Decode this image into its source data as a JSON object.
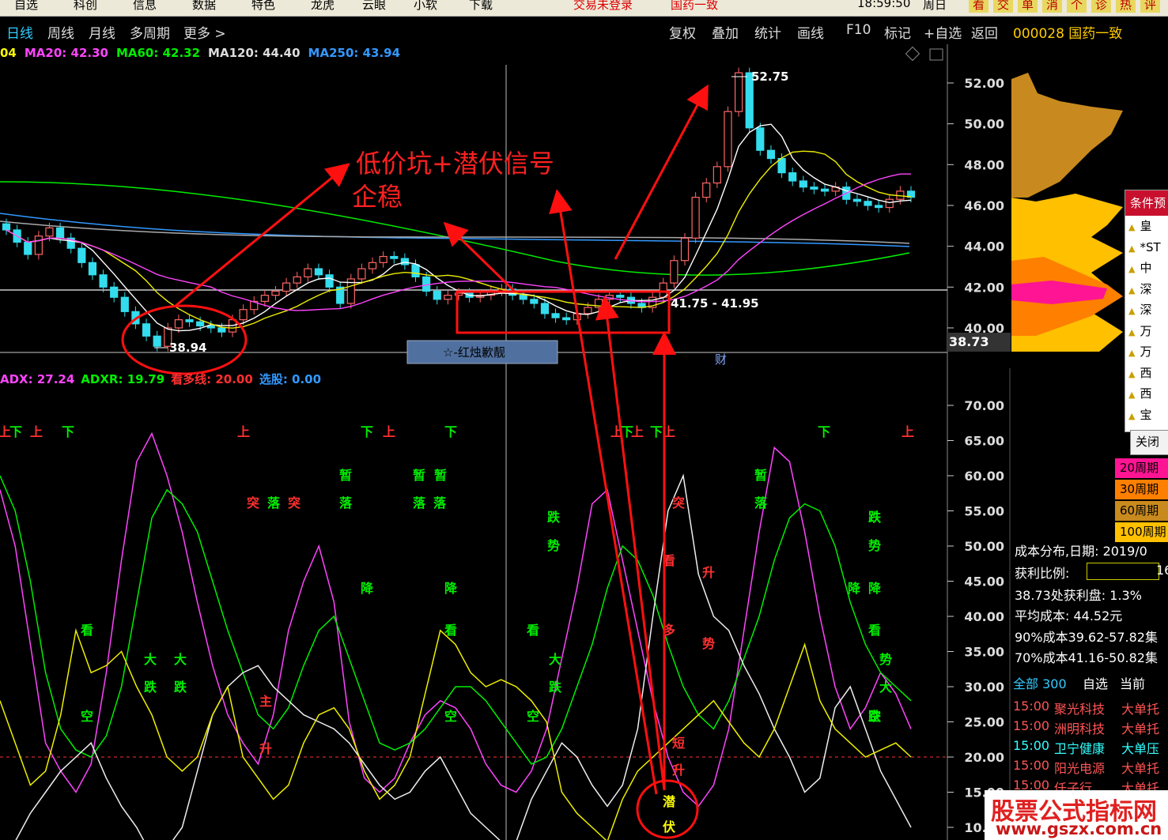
{
  "menu": {
    "items": [
      "自选",
      "科创",
      "信息",
      "数据",
      "特色",
      "龙虎",
      "云眼",
      "小软",
      "下载"
    ],
    "login": "交易未登录",
    "stock_name": "国药一致",
    "time": "18:59:50",
    "weekday": "周日",
    "right_buttons": [
      "看",
      "交",
      "单",
      "消",
      "个",
      "诊",
      "热",
      "评"
    ]
  },
  "toolbar": {
    "periods": [
      "日线",
      "周线",
      "月线",
      "多周期",
      "更多 >"
    ],
    "actions": [
      "复权",
      "叠加",
      "统计",
      "画线",
      "F10",
      "标记",
      "+自选",
      "返回"
    ],
    "stock_code": "000028 国药一致"
  },
  "ma_legend": [
    {
      "label": "04",
      "color": "#ffff00"
    },
    {
      "label": "MA20: 42.30",
      "color": "#ff44ff"
    },
    {
      "label": "MA60: 42.32",
      "color": "#00ee00"
    },
    {
      "label": "MA120: 44.40",
      "color": "#dddddd"
    },
    {
      "label": "MA250: 43.94",
      "color": "#3399ff"
    }
  ],
  "adx_legend": [
    {
      "label": "ADX: 27.24",
      "color": "#ff44ff"
    },
    {
      "label": "ADXR: 19.79",
      "color": "#00ee00"
    },
    {
      "label": "看多线: 20.00",
      "color": "#ff3030"
    },
    {
      "label": "选股: 0.00",
      "color": "#3399ff"
    }
  ],
  "annotations": {
    "main_text_line1": "低价坑+潜伏信号",
    "main_text_line2": "企稳",
    "peak_label": "52.75",
    "low_label": "38.94",
    "range_label": "41.75 - 41.95",
    "price_marker": "38.73",
    "event_box": "☆-红烛歉靓",
    "cai_mark": "财"
  },
  "price_axis": {
    "ticks": [
      "52.00",
      "50.00",
      "48.00",
      "46.00",
      "44.00",
      "42.00",
      "40.00"
    ]
  },
  "indicator_axis": {
    "ticks": [
      "70.00",
      "65.00",
      "60.00",
      "55.00",
      "50.00",
      "45.00",
      "40.00",
      "35.00",
      "30.00",
      "25.00",
      "20.00",
      "15.00",
      "10.00"
    ]
  },
  "cost_info": {
    "lines": [
      "成本分布,日期: 2019/0",
      "获利比例:",
      "38.73处获利盘: 1.3%",
      "平均成本: 44.52元",
      "90%成本39.62-57.82集",
      "70%成本41.16-50.82集"
    ],
    "profit_value": "16"
  },
  "condition_panel": {
    "title": "条件预",
    "items": [
      "皇",
      "*ST",
      "中",
      "深",
      "深",
      "万",
      "万",
      "西",
      "西",
      "宝"
    ],
    "close": "关闭"
  },
  "periods_legend": [
    {
      "label": "20周期",
      "color": "#ff1493"
    },
    {
      "label": "30周期",
      "color": "#ff7f00"
    },
    {
      "label": "60周期",
      "color": "#c88a1e"
    },
    {
      "label": "100周期",
      "color": "#ffc000"
    }
  ],
  "list_tabs": [
    "全部 300",
    "自选",
    "当前"
  ],
  "news": [
    {
      "time": "15:00",
      "name": "聚光科技",
      "event": "大单托",
      "color": "#ff5555"
    },
    {
      "time": "15:00",
      "name": "洲明科技",
      "event": "大单托",
      "color": "#ff5555"
    },
    {
      "time": "15:00",
      "name": "卫宁健康",
      "event": "大单压",
      "color": "#33ffff"
    },
    {
      "time": "15:00",
      "name": "阳光电源",
      "event": "大单托",
      "color": "#ff5555"
    },
    {
      "time": "15:00",
      "name": "仟子行",
      "event": "大单托",
      "color": "#ff5555"
    }
  ],
  "signal_words": [
    "上",
    "下",
    "上",
    "下",
    "上",
    "下",
    "上",
    "下",
    "上",
    "下",
    "上",
    "下",
    "上",
    "下",
    "上",
    "暂",
    "暂",
    "暂",
    "暂",
    "突",
    "落",
    "突",
    "落",
    "落",
    "落",
    "落",
    "跌",
    "势",
    "降",
    "降",
    "降",
    "降",
    "看",
    "看",
    "看",
    "看",
    "大",
    "大",
    "大",
    "跌",
    "跌",
    "跌",
    "空",
    "空",
    "空",
    "空",
    "跌",
    "势",
    "主",
    "升",
    "看",
    "多",
    "升",
    "势",
    "突",
    "短",
    "升",
    "潜",
    "伏",
    "跌",
    "势",
    "大",
    "跌",
    "空"
  ],
  "watermark": {
    "line1": "股票公式指标网",
    "line2": "www.gszx.com.cn"
  },
  "chart_data": [
    {
      "type": "candlestick",
      "title": "",
      "ylim": [
        38.73,
        53.2
      ],
      "peak": 52.75,
      "trough": 38.94,
      "moving_averages": {
        "MA20": 42.3,
        "MA60": 42.32,
        "MA120": 44.4,
        "MA250": 43.94
      },
      "closes": [
        44.8,
        44.2,
        43.6,
        44.5,
        44.9,
        44.4,
        43.9,
        43.2,
        42.6,
        42.0,
        41.5,
        40.8,
        40.2,
        39.6,
        39.1,
        40.0,
        40.4,
        40.3,
        40.1,
        40.0,
        39.8,
        40.4,
        40.9,
        41.3,
        41.6,
        41.8,
        42.2,
        42.5,
        42.9,
        42.6,
        42.0,
        41.2,
        42.4,
        42.9,
        43.2,
        43.5,
        43.4,
        43.1,
        42.5,
        41.8,
        41.4,
        41.6,
        41.7,
        41.5,
        41.6,
        41.8,
        41.9,
        41.6,
        41.4,
        41.2,
        40.7,
        40.5,
        40.4,
        40.7,
        41.0,
        41.4,
        41.6,
        41.5,
        41.2,
        41.0,
        41.5,
        42.2,
        43.3,
        44.4,
        46.4,
        47.1,
        47.9,
        50.6,
        52.5,
        49.8,
        48.7,
        48.3,
        47.6,
        47.2,
        46.9,
        46.8,
        46.7,
        46.9,
        46.3,
        46.2,
        46.0,
        45.9,
        46.3,
        46.7,
        46.4
      ],
      "colors": {
        "up": "#ff6666",
        "down": "#33ddee"
      }
    },
    {
      "type": "line",
      "title": "ADX",
      "ylim": [
        9,
        74
      ],
      "ref_line": 20.0,
      "series": [
        {
          "name": "ADX",
          "color": "#ff44ff",
          "values": [
            58,
            50,
            36,
            22,
            18,
            15,
            19,
            32,
            48,
            62,
            66,
            60,
            52,
            42,
            33,
            26,
            22,
            19,
            26,
            38,
            45,
            50,
            42,
            25,
            17,
            15,
            17,
            22,
            26,
            28,
            27,
            24,
            19,
            16,
            15,
            18,
            24,
            34,
            44,
            56,
            58,
            48,
            38,
            28,
            20,
            15,
            13,
            16,
            24,
            38,
            52,
            64,
            62,
            52,
            40,
            30,
            24,
            27,
            32,
            29,
            24
          ]
        },
        {
          "name": "ADXR",
          "color": "#00ee00",
          "values": [
            60,
            55,
            45,
            32,
            24,
            21,
            20,
            23,
            30,
            42,
            54,
            58,
            56,
            52,
            45,
            38,
            32,
            26,
            24,
            27,
            33,
            38,
            40,
            34,
            28,
            22,
            21,
            22,
            24,
            27,
            30,
            30,
            28,
            25,
            22,
            19,
            20,
            24,
            30,
            36,
            44,
            50,
            48,
            43,
            36,
            30,
            26,
            24,
            28,
            34,
            40,
            48,
            54,
            56,
            55,
            50,
            42,
            36,
            32,
            30,
            28
          ]
        },
        {
          "name": "",
          "color": "#eeeeee",
          "values": [
            5,
            8,
            12,
            15,
            18,
            20,
            22,
            17,
            13,
            10,
            6,
            7,
            10,
            18,
            26,
            30,
            32,
            33,
            30,
            28,
            26,
            25,
            24,
            22,
            19,
            16,
            14,
            15,
            18,
            20,
            16,
            12,
            10,
            8,
            8,
            14,
            18,
            22,
            20,
            16,
            13,
            16,
            24,
            40,
            55,
            60,
            46,
            40,
            38,
            33,
            29,
            24,
            20,
            15,
            17,
            27,
            30,
            24,
            18,
            14,
            10
          ]
        },
        {
          "name": "",
          "color": "#eeee00",
          "values": [
            28,
            22,
            16,
            18,
            26,
            38,
            32,
            33,
            35,
            30,
            26,
            20,
            18,
            20,
            26,
            30,
            20,
            17,
            14,
            16,
            22,
            26,
            27,
            24,
            18,
            14,
            16,
            20,
            29,
            38,
            36,
            32,
            30,
            31,
            30,
            28,
            25,
            15,
            12,
            10,
            8,
            14,
            18,
            20,
            22,
            24,
            26,
            28,
            25,
            22,
            20,
            24,
            30,
            36,
            28,
            24,
            22,
            20,
            21,
            22,
            20
          ]
        }
      ]
    }
  ]
}
